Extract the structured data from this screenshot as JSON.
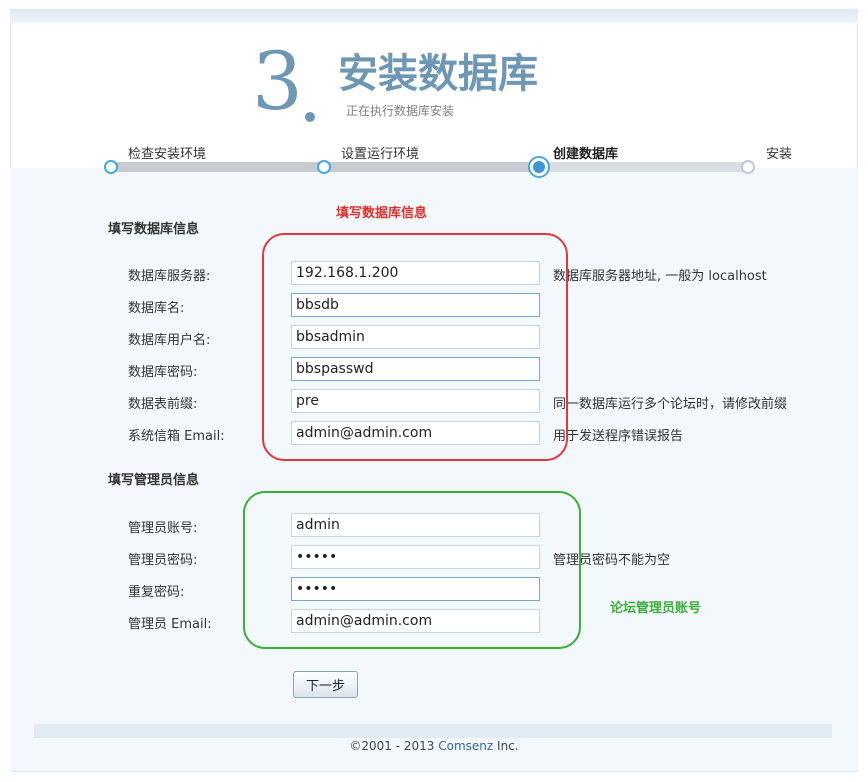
{
  "header": {
    "step_number": "3",
    "title": "安装数据库",
    "subtitle": "正在执行数据库安装"
  },
  "steps": [
    {
      "label": "检查安装环境",
      "state": "done"
    },
    {
      "label": "设置运行环境",
      "state": "done"
    },
    {
      "label": "创建数据库",
      "state": "current"
    },
    {
      "label": "安装",
      "state": "pending"
    }
  ],
  "progress": {
    "completed_fraction": 0.67
  },
  "db_section": {
    "title": "填写数据库信息",
    "annotation": "填写数据库信息",
    "fields": [
      {
        "label": "数据库服务器:",
        "value": "192.168.1.200",
        "hint": "数据库服务器地址, 一般为 localhost"
      },
      {
        "label": "数据库名:",
        "value": "bbsdb",
        "hint": ""
      },
      {
        "label": "数据库用户名:",
        "value": "bbsadmin",
        "hint": ""
      },
      {
        "label": "数据库密码:",
        "value": "bbspasswd",
        "hint": ""
      },
      {
        "label": "数据表前缀:",
        "value": "pre",
        "hint": "同一数据库运行多个论坛时，请修改前缀"
      },
      {
        "label": "系统信箱 Email:",
        "value": "admin@admin.com",
        "hint": "用于发送程序错误报告"
      }
    ]
  },
  "admin_section": {
    "title": "填写管理员信息",
    "annotation": "论坛管理员账号",
    "fields": [
      {
        "label": "管理员账号:",
        "value": "admin",
        "type": "text",
        "hint": ""
      },
      {
        "label": "管理员密码:",
        "value": "admin",
        "type": "password",
        "hint": "管理员密码不能为空"
      },
      {
        "label": "重复密码:",
        "value": "admin",
        "type": "password",
        "hint": ""
      },
      {
        "label": "管理员 Email:",
        "value": "admin@admin.com",
        "type": "text",
        "hint": ""
      }
    ]
  },
  "next_button": "下一步",
  "footer": {
    "prefix": "©2001 - 2013 ",
    "company": "Comsenz",
    "suffix": " Inc."
  },
  "colors": {
    "title": "#6d97b2",
    "annotation_red": "#e0383c",
    "annotation_green": "#3cae3a",
    "progress_active": "#4aa6dc"
  }
}
